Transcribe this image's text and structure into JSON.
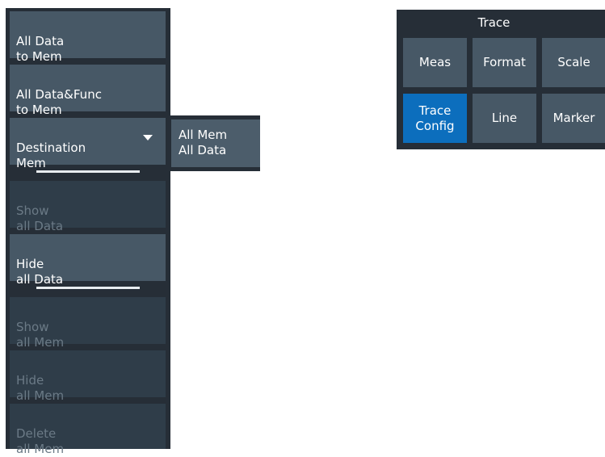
{
  "left_panel": {
    "buttons": [
      {
        "label": "All Data\nto Mem",
        "enabled": true
      },
      {
        "label": "All Data&Func\nto Mem",
        "enabled": true
      },
      {
        "label": "Destination\nMem",
        "enabled": true,
        "dropdown": true
      },
      {
        "label": "Show\nall Data",
        "enabled": false
      },
      {
        "label": "Hide\nall Data",
        "enabled": true
      },
      {
        "label": "Show\nall Mem",
        "enabled": false
      },
      {
        "label": "Hide\nall Mem",
        "enabled": false
      },
      {
        "label": "Delete\nall Mem",
        "enabled": false
      }
    ]
  },
  "dropdown_popup": {
    "items": [
      "All Mem",
      "All Data"
    ]
  },
  "trace_menu": {
    "title": "Trace",
    "buttons": [
      {
        "label": "Meas",
        "active": false
      },
      {
        "label": "Format",
        "active": false
      },
      {
        "label": "Scale",
        "active": false
      },
      {
        "label": "Trace\nConfig",
        "active": true
      },
      {
        "label": "Line",
        "active": false
      },
      {
        "label": "Marker",
        "active": false
      }
    ]
  },
  "colors": {
    "panel_bg": "#262e37",
    "button_bg": "#475866",
    "button_disabled_bg": "#2f3d49",
    "active_blue": "#0c6ebd"
  }
}
